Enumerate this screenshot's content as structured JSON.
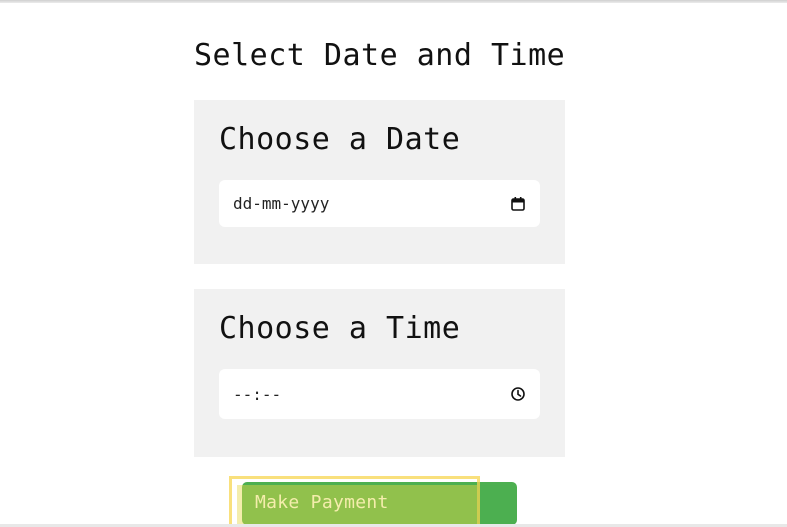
{
  "page": {
    "title": "Select Date and Time"
  },
  "date_section": {
    "heading": "Choose a Date",
    "input_placeholder": "dd-mm-yyyy",
    "icon": "calendar-icon"
  },
  "time_section": {
    "heading": "Choose a Time",
    "input_placeholder": "--:--",
    "icon": "clock-icon"
  },
  "actions": {
    "pay_label": "Make Payment",
    "pay_color": "#4caf50"
  },
  "colors": {
    "panel_bg": "#f1f1f1",
    "highlight": "#f7d650"
  }
}
